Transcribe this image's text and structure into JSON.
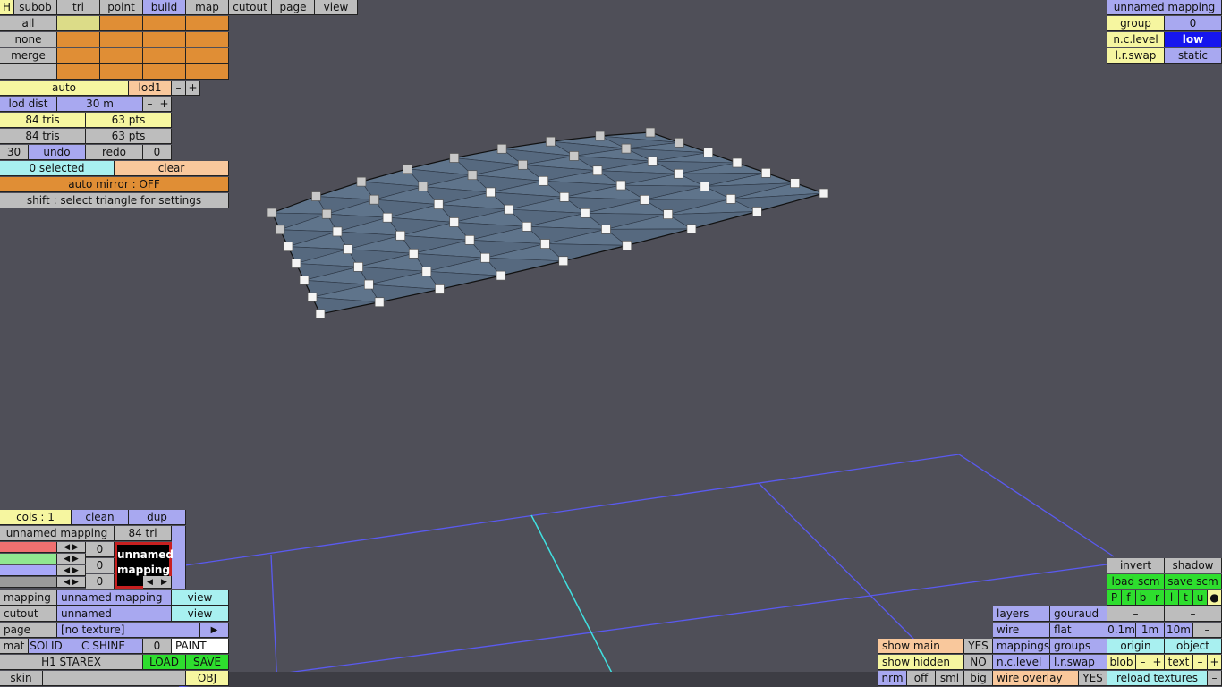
{
  "menu": {
    "tabs": [
      "H",
      "subob",
      "tri",
      "point",
      "build",
      "map",
      "cutout",
      "page",
      "view"
    ]
  },
  "sel": {
    "all": "all",
    "none": "none",
    "merge": "merge",
    "dash": "–"
  },
  "lod": {
    "auto": "auto",
    "name": "lod1",
    "minus": "–",
    "plus": "+",
    "dist_label": "lod dist",
    "dist_value": "30 m",
    "tris1": "84 tris",
    "pts1": "63 pts",
    "tris2": "84 tris",
    "pts2": "63 pts",
    "undo_count": "30",
    "undo": "undo",
    "redo": "redo",
    "redo_count": "0",
    "selected": "0 selected",
    "clear": "clear",
    "mirror": "auto mirror : OFF",
    "hint": "shift : select triangle for settings"
  },
  "mapping_panel": {
    "title": "unnamed mapping",
    "group_label": "group",
    "group_value": "0",
    "nc_label": "n.c.level",
    "nc_value": "low",
    "swap_label": "l.r.swap",
    "swap_value": "static"
  },
  "material": {
    "cols": "cols : 1",
    "clean": "clean",
    "dup": "dup",
    "name": "unnamed mapping",
    "tri_count": "84 tri",
    "ch1": "0",
    "ch2": "0",
    "ch3": "0",
    "preview_line1": "unnamed",
    "preview_line2": "mapping",
    "arrow_l": "◀",
    "arrow_r": "▶",
    "mapping_label": "mapping",
    "mapping_value": "unnamed mapping",
    "mapping_view": "view",
    "cutout_label": "cutout",
    "cutout_value": "unnamed",
    "cutout_view": "view",
    "page_label": "page",
    "page_value": "[no texture]",
    "page_arrow": "▶",
    "mat": "mat",
    "solid": "SOLID",
    "shine": "C SHINE",
    "mat_num": "0",
    "paint": "PAINT",
    "file": "H1 STAREX",
    "load": "LOAD",
    "save": "SAVE",
    "skin": "skin",
    "obj": "OBJ"
  },
  "view_panel": {
    "show_main": "show main",
    "show_main_v": "YES",
    "show_hidden": "show hidden",
    "show_hidden_v": "NO",
    "nrm": "nrm",
    "off": "off",
    "sml": "sml",
    "big": "big",
    "layers": "layers",
    "gouraud": "gouraud",
    "wire": "wire",
    "flat": "flat",
    "mappings": "mappings",
    "groups": "groups",
    "nclevel": "n.c.level",
    "lrswap": "l.r.swap",
    "wire_overlay": "wire overlay",
    "wire_overlay_v": "YES",
    "invert": "invert",
    "shadow": "shadow",
    "load_scm": "load scm",
    "save_scm": "save scm",
    "views": [
      "P",
      "f",
      "b",
      "r",
      "l",
      "t",
      "u",
      "●"
    ],
    "dash1": "–",
    "dash2": "–",
    "g01": "0.1m",
    "g1": "1m",
    "g10": "10m",
    "gminus": "–",
    "origin": "origin",
    "object": "object",
    "blob": "blob",
    "blob_m": "–",
    "blob_p": "+",
    "text": "text",
    "text_m": "–",
    "text_p": "+",
    "reload": "reload textures",
    "reload_m": "–"
  },
  "colors": {
    "background": "#4f4f58",
    "mesh": "#5b6f86",
    "grid": "#5a5af0",
    "axis": "#40e0e0"
  }
}
